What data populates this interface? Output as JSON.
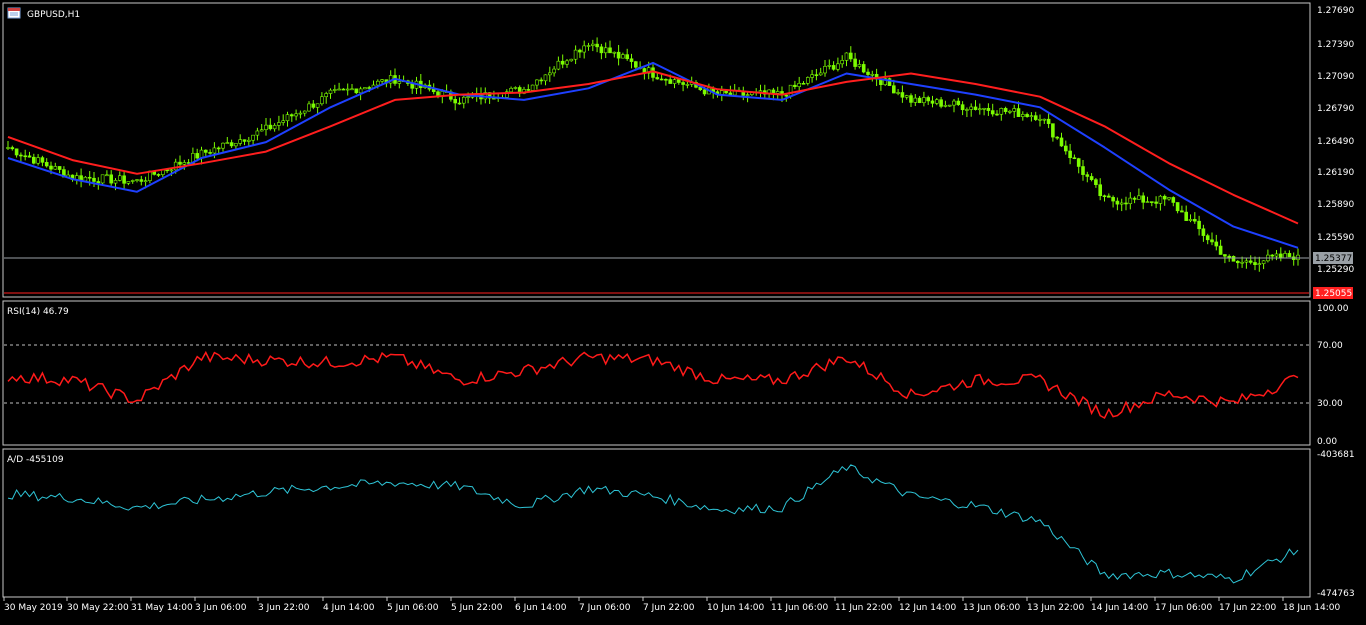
{
  "chart": {
    "symbol_title": "GBPUSD,H1",
    "colors": {
      "background": "#000000",
      "frame": "#c8c8c8",
      "bull_candle": "#7cfc00",
      "bear_candle": "#7cfc00",
      "ma_fast": "#1e40ff",
      "ma_slow": "#ff1e1e",
      "bid_line": "#9aa0a6",
      "ask_line": "#ff2020",
      "rsi_line": "#ff1a1a",
      "ad_line": "#2ec4d6",
      "level_dash": "#bfbfbf"
    },
    "price_axis": [
      "1.27690",
      "1.27390",
      "1.27090",
      "1.26790",
      "1.26490",
      "1.26190",
      "1.25890",
      "1.25590",
      "1.25290"
    ],
    "bid_tag": "1.25377",
    "ask_tag": "1.25055",
    "time_axis": [
      "30 May 2019",
      "30 May 22:00",
      "31 May 14:00",
      "3 Jun 06:00",
      "3 Jun 22:00",
      "4 Jun 14:00",
      "5 Jun 06:00",
      "5 Jun 22:00",
      "6 Jun 14:00",
      "7 Jun 06:00",
      "7 Jun 22:00",
      "10 Jun 14:00",
      "11 Jun 06:00",
      "11 Jun 22:00",
      "12 Jun 14:00",
      "13 Jun 06:00",
      "13 Jun 22:00",
      "14 Jun 14:00",
      "17 Jun 06:00",
      "17 Jun 22:00",
      "18 Jun 14:00"
    ]
  },
  "rsi": {
    "title": "RSI(14) 46.79",
    "levels": [
      "100.00",
      "70.00",
      "30.00",
      "0.00"
    ]
  },
  "ad": {
    "title": "A/D -455109",
    "levels": [
      "-403681",
      "-474763"
    ]
  },
  "chart_data": [
    {
      "type": "line",
      "title": "GBPUSD,H1",
      "ylim": [
        1.2505,
        1.2772
      ],
      "x": [
        "30 May 2019",
        "30 May 22:00",
        "31 May 14:00",
        "3 Jun 06:00",
        "3 Jun 22:00",
        "4 Jun 14:00",
        "5 Jun 06:00",
        "5 Jun 22:00",
        "6 Jun 14:00",
        "7 Jun 06:00",
        "7 Jun 22:00",
        "10 Jun 14:00",
        "11 Jun 06:00",
        "11 Jun 22:00",
        "12 Jun 14:00",
        "13 Jun 06:00",
        "13 Jun 22:00",
        "14 Jun 14:00",
        "17 Jun 06:00",
        "17 Jun 22:00",
        "18 Jun 14:00"
      ],
      "series": [
        {
          "values": [
            1.264,
            1.2612,
            1.2608,
            1.2634,
            1.2657,
            1.269,
            1.2705,
            1.2685,
            1.2695,
            1.274,
            1.271,
            1.269,
            1.269,
            1.2725,
            1.2685,
            1.2678,
            1.267,
            1.259,
            1.259,
            1.253,
            1.2538
          ]
        },
        {
          "values": [
            1.263,
            1.261,
            1.2598,
            1.263,
            1.2645,
            1.2678,
            1.2705,
            1.269,
            1.2685,
            1.2696,
            1.272,
            1.269,
            1.2685,
            1.271,
            1.27,
            1.269,
            1.2678,
            1.264,
            1.26,
            1.2565,
            1.2545
          ]
        },
        {
          "values": [
            1.265,
            1.2628,
            1.2615,
            1.2625,
            1.2636,
            1.266,
            1.2685,
            1.269,
            1.2692,
            1.27,
            1.2712,
            1.2695,
            1.269,
            1.2702,
            1.271,
            1.27,
            1.2688,
            1.266,
            1.2625,
            1.2595,
            1.2568
          ]
        }
      ]
    },
    {
      "type": "line",
      "title": "RSI(14) 46.79",
      "ylim": [
        0,
        100
      ],
      "x": [
        "30 May 2019",
        "30 May 22:00",
        "31 May 14:00",
        "3 Jun 06:00",
        "3 Jun 22:00",
        "4 Jun 14:00",
        "5 Jun 06:00",
        "5 Jun 22:00",
        "6 Jun 14:00",
        "7 Jun 06:00",
        "7 Jun 22:00",
        "10 Jun 14:00",
        "11 Jun 06:00",
        "11 Jun 22:00",
        "12 Jun 14:00",
        "13 Jun 06:00",
        "13 Jun 22:00",
        "14 Jun 14:00",
        "17 Jun 06:00",
        "17 Jun 22:00",
        "18 Jun 14:00"
      ],
      "series": [
        {
          "values": [
            48,
            45,
            30,
            62,
            60,
            58,
            62,
            45,
            52,
            62,
            60,
            45,
            45,
            62,
            34,
            45,
            45,
            20,
            35,
            28,
            47
          ]
        }
      ]
    },
    {
      "type": "line",
      "title": "A/D -455109",
      "ylim": [
        -474763,
        -403681
      ],
      "x": [
        "30 May 2019",
        "30 May 22:00",
        "31 May 14:00",
        "3 Jun 06:00",
        "3 Jun 22:00",
        "4 Jun 14:00",
        "5 Jun 06:00",
        "5 Jun 22:00",
        "6 Jun 14:00",
        "7 Jun 06:00",
        "7 Jun 22:00",
        "10 Jun 14:00",
        "11 Jun 06:00",
        "11 Jun 22:00",
        "12 Jun 14:00",
        "13 Jun 06:00",
        "13 Jun 22:00",
        "14 Jun 14:00",
        "17 Jun 06:00",
        "17 Jun 22:00",
        "18 Jun 14:00"
      ],
      "series": [
        {
          "values": [
            -424000,
            -426000,
            -431000,
            -427000,
            -423000,
            -420000,
            -418000,
            -420000,
            -430000,
            -421000,
            -425000,
            -432000,
            -431000,
            -410000,
            -425000,
            -430000,
            -438000,
            -466000,
            -465000,
            -468000,
            -453000
          ]
        }
      ]
    }
  ]
}
